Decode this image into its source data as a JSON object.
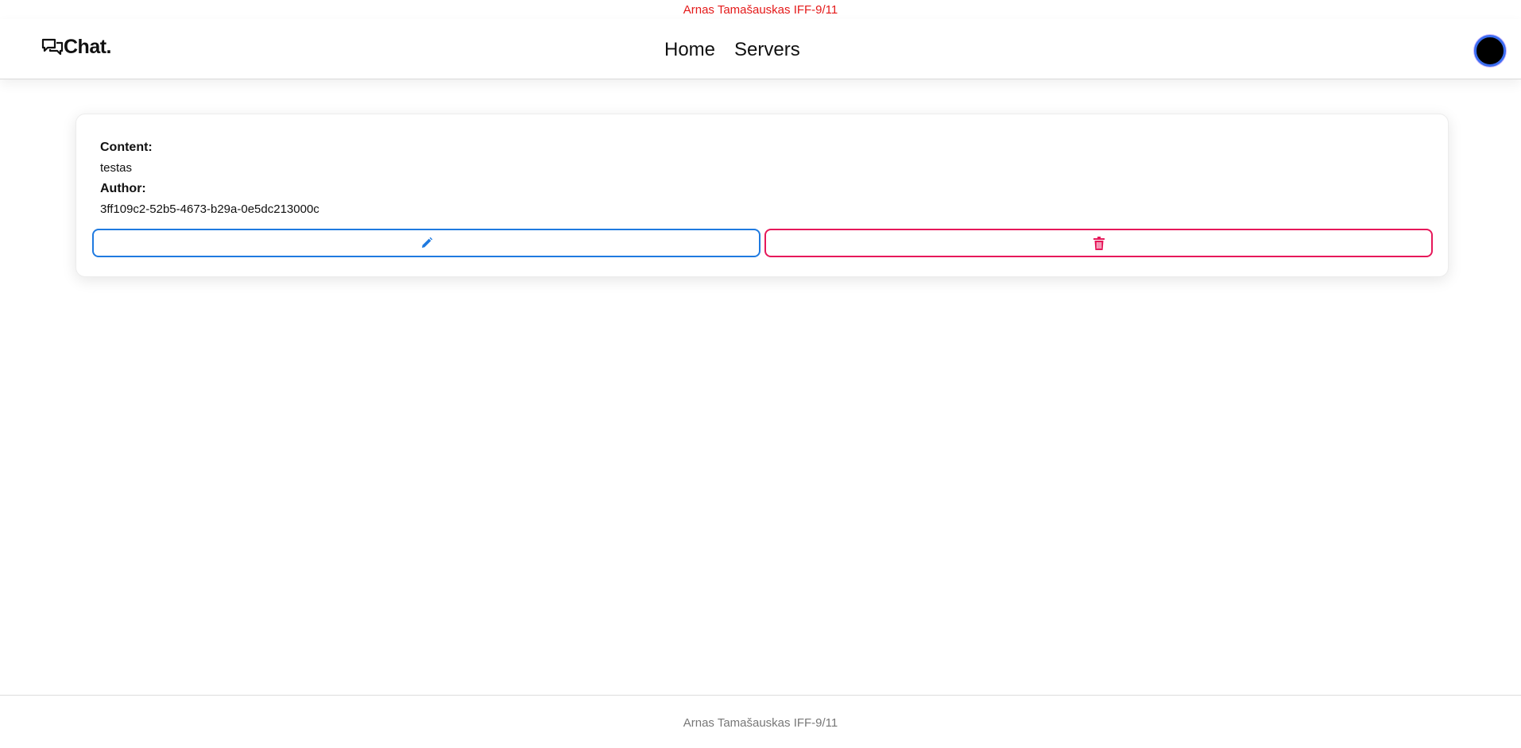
{
  "banner": {
    "text": "Arnas Tamašauskas IFF-9/11"
  },
  "navbar": {
    "brand": "Chat.",
    "links": [
      {
        "label": "Home"
      },
      {
        "label": "Servers"
      }
    ]
  },
  "message": {
    "content_label": "Content:",
    "content_value": "testas",
    "author_label": "Author:",
    "author_value": "3ff109c2-52b5-4673-b29a-0e5dc213000c"
  },
  "actions": {
    "edit_icon": "pencil-icon",
    "delete_icon": "trash-icon",
    "edit_color": "#1f7ae0",
    "delete_color": "#e6185a"
  },
  "footer": {
    "text": "Arnas Tamašauskas IFF-9/11"
  },
  "colors": {
    "banner_text": "#e41919",
    "footer_text": "#777777"
  }
}
